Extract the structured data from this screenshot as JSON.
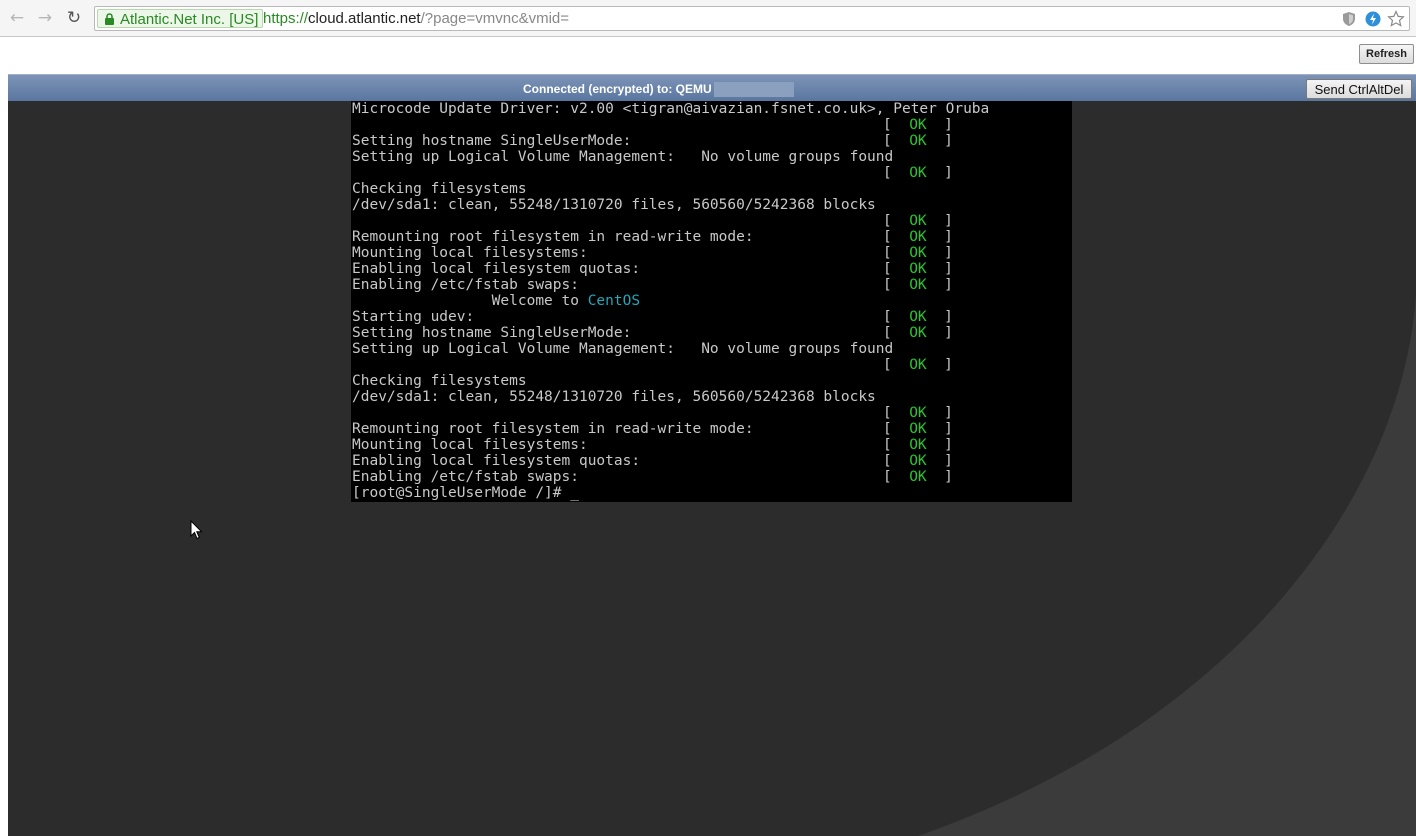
{
  "browser": {
    "ev_badge": "Atlantic.Net Inc. [US]",
    "url_scheme": "https://",
    "url_host": "cloud.atlantic.net",
    "url_path": "/?page=vmvnc&vmid=",
    "icons": [
      "back-icon",
      "forward-icon",
      "reload-icon",
      "lock-icon",
      "shield-icon",
      "lightning-icon",
      "star-icon"
    ]
  },
  "page": {
    "refresh_label": "Refresh"
  },
  "vnc": {
    "status_text": "Connected (encrypted) to: QEMU",
    "send_ctrlaltdel_label": "Send CtrlAltDel",
    "colors": {
      "status_bar": "#6b85ac",
      "ok_green": "#2ec42e",
      "centos_cyan": "#22a6b8"
    }
  },
  "console": {
    "lines": [
      "Microcode Update Driver: v2.00 <tigran@aivazian.fsnet.co.uk>, Peter Oruba",
      "",
      "Setting hostname SingleUserMode:",
      "Setting up Logical Volume Management:   No volume groups found",
      "",
      "Checking filesystems",
      "/dev/sda1: clean, 55248/1310720 files, 560560/5242368 blocks",
      "",
      "Remounting root filesystem in read-write mode:",
      "Mounting local filesystems:",
      "Enabling local filesystem quotas:",
      "Enabling /etc/fstab swaps:",
      "                Welcome to ",
      "Starting udev:",
      "Setting hostname SingleUserMode:",
      "Setting up Logical Volume Management:   No volume groups found",
      "",
      "Checking filesystems",
      "/dev/sda1: clean, 55248/1310720 files, 560560/5242368 blocks",
      "",
      "Remounting root filesystem in read-write mode:",
      "Mounting local filesystems:",
      "Enabling local filesystem quotas:",
      "Enabling /etc/fstab swaps:",
      "[root@SingleUserMode /]# "
    ],
    "ok_rows": [
      1,
      2,
      4,
      7,
      8,
      9,
      10,
      11,
      13,
      14,
      16,
      19,
      20,
      21,
      22,
      23
    ],
    "ok_open": "[  ",
    "ok_word": "OK",
    "ok_close": "  ]",
    "welcome_row": 12,
    "welcome_brand": "CentOS",
    "prompt_row": 24,
    "cursor": "_"
  }
}
